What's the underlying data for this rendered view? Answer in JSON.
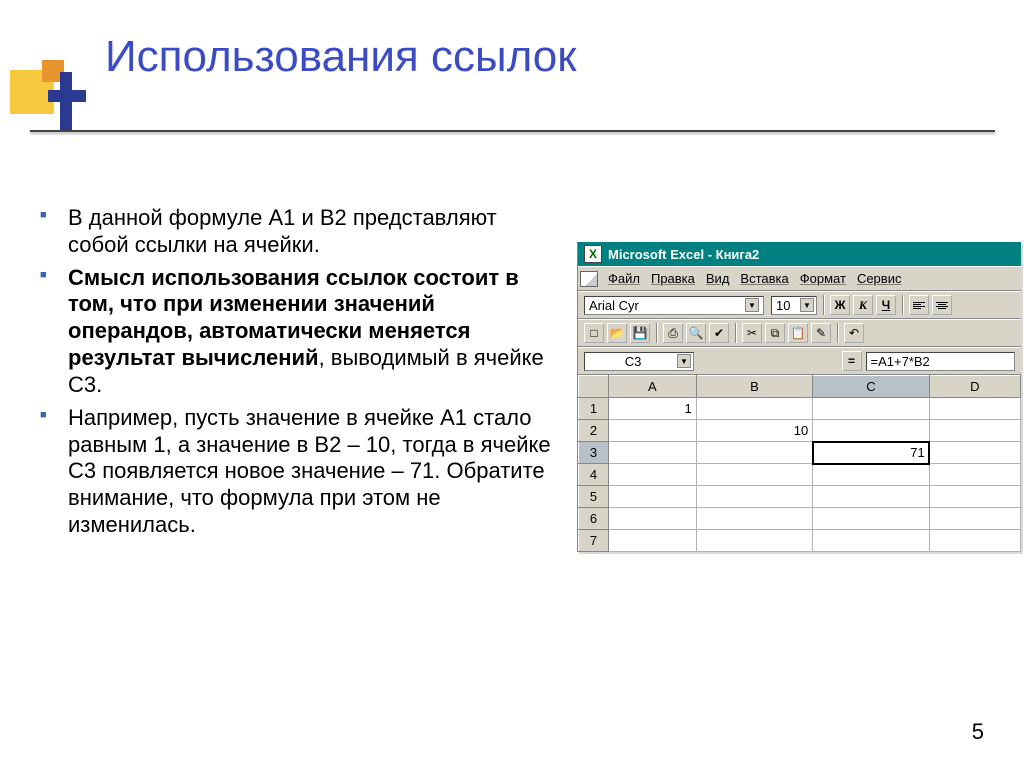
{
  "title": "Использования ссылок",
  "bullets": [
    {
      "html": "В данной формуле A1 и B2 представляют собой ссылки на ячейки."
    },
    {
      "html": "<b>Смысл использования ссылок состоит в том, что при изменении значений операндов, автоматически меняется результат вычислений</b>, выводимый в ячейке C3."
    },
    {
      "html": "Например, пусть значение в ячейке A1 стало равным 1, а значение в B2 – 10, тогда в ячейке C3 появляется новое значение – 71. Обратите внимание, что формула при этом не изменилась."
    }
  ],
  "page_number": "5",
  "excel": {
    "title": "Microsoft Excel - Книга2",
    "menus": [
      "Файл",
      "Правка",
      "Вид",
      "Вставка",
      "Формат",
      "Сервис"
    ],
    "font_name": "Arial Cyr",
    "font_size": "10",
    "bold_label": "Ж",
    "italic_label": "К",
    "underline_label": "Ч",
    "name_box": "C3",
    "equals_label": "=",
    "formula": "=A1+7*B2",
    "columns": [
      "A",
      "B",
      "C",
      "D"
    ],
    "rows": [
      {
        "n": "1",
        "cells": [
          "1",
          "",
          "",
          ""
        ]
      },
      {
        "n": "2",
        "cells": [
          "",
          "10",
          "",
          ""
        ]
      },
      {
        "n": "3",
        "cells": [
          "",
          "",
          "71",
          ""
        ],
        "active_col": 2
      },
      {
        "n": "4",
        "cells": [
          "",
          "",
          "",
          ""
        ]
      },
      {
        "n": "5",
        "cells": [
          "",
          "",
          "",
          ""
        ]
      },
      {
        "n": "6",
        "cells": [
          "",
          "",
          "",
          ""
        ]
      },
      {
        "n": "7",
        "cells": [
          "",
          "",
          "",
          ""
        ]
      }
    ],
    "active_col_index": 2,
    "active_row_index": 2
  }
}
